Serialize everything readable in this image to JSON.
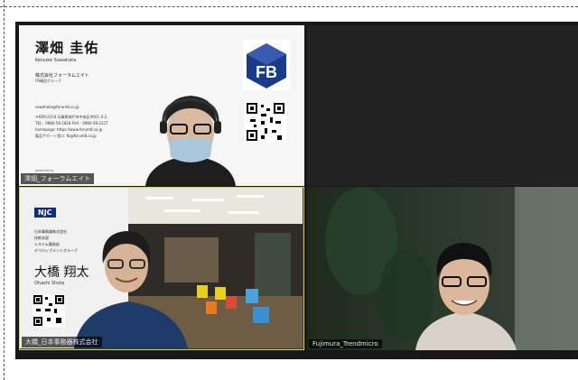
{
  "participants": [
    {
      "id": "tile1",
      "display_name": "澤畑_フォーラムエイト",
      "card": {
        "name_jp": "澤畑 圭佑",
        "name_en": "Keisuke Sawahata",
        "company": "株式会社フォーラムエイト",
        "department": "FB構造グループ",
        "email": "sawahata@forum8.co.jp",
        "address": "〒669-2154 兵庫県神戸市中央区中町1-3-2",
        "tel": "TEL：0980-58-1818 FAX：0980-58-2227",
        "homepage": "homepage: https://www.forum8.co.jp",
        "support": "製品サポート窓口: fb@forum8.co.jp",
        "powered": "powered by"
      }
    },
    {
      "id": "tile2",
      "display_name": ""
    },
    {
      "id": "tile3",
      "display_name": "大橋_日本事務器株式会社",
      "card": {
        "logo": "NJC",
        "org_lines": [
          "日本事務器株式会社",
          "技術本部",
          "システム開発部",
          "デベロップメントグループ"
        ],
        "name_jp": "大橋 翔太",
        "name_en": "Ohashi Shota"
      }
    },
    {
      "id": "tile4",
      "display_name": "Fujimura_Trendmicro"
    }
  ],
  "colors": {
    "active_speaker_border": "#c9d75a",
    "logo_fb": "#1a3a8a",
    "logo_njc": "#0a2e7a"
  },
  "icons": [
    "fb-logo-icon",
    "qr-code-icon",
    "njc-logo-icon"
  ]
}
